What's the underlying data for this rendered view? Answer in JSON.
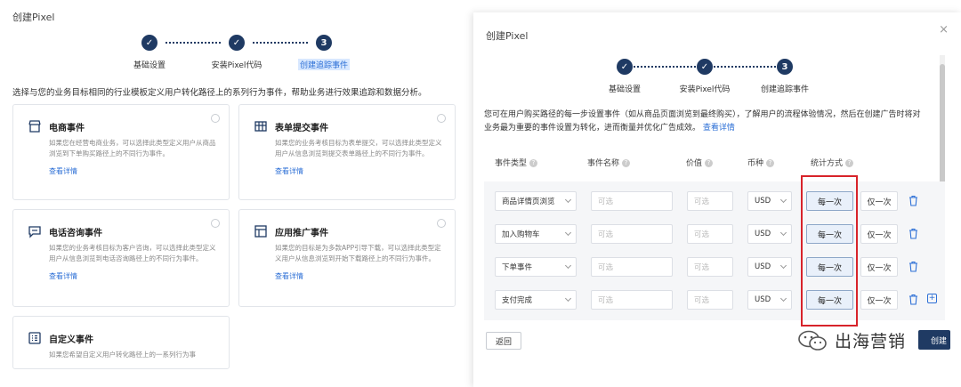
{
  "left": {
    "title": "创建Pixel",
    "steps": [
      {
        "label": "基础设置",
        "num": "✓"
      },
      {
        "label": "安装Pixel代码",
        "num": "✓"
      },
      {
        "label": "创建追踪事件",
        "num": "3"
      }
    ],
    "description": "选择与您的业务目标相同的行业模板定义用户转化路径上的系列行为事件，帮助业务进行效果追踪和数据分析。",
    "cards": [
      {
        "title": "电商事件",
        "desc": "如果您在经营电商业务，可以选择此类型定义用户从商品浏览到下单购买路径上的不同行为事件。",
        "link": "查看详情"
      },
      {
        "title": "表单提交事件",
        "desc": "如果您的业务考核目标为表单提交，可以选择此类型定义用户从信息浏览到提交表单路径上的不同行为事件。",
        "link": "查看详情"
      },
      {
        "title": "电话咨询事件",
        "desc": "如果您的业务考核目标为客户咨询，可以选择此类型定义用户从信息浏览到电话咨询路径上的不同行为事件。",
        "link": "查看详情"
      },
      {
        "title": "应用推广事件",
        "desc": "如果您的目标是为多款APP引导下载，可以选择此类型定义用户从信息浏览到开始下载路径上的不同行为事件。",
        "link": "查看详情"
      },
      {
        "title": "自定义事件",
        "desc": "如果您希望自定义用户转化路径上的一系列行为事",
        "link": ""
      }
    ]
  },
  "right": {
    "title": "创建Pixel",
    "close": "×",
    "steps": [
      {
        "label": "基础设置",
        "num": "✓"
      },
      {
        "label": "安装Pixel代码",
        "num": "✓"
      },
      {
        "label": "创建追踪事件",
        "num": "3"
      }
    ],
    "description": "您可在用户购买路径的每一步设置事件（如从商品页面浏览到最终购买），了解用户的流程体验情况，然后在创建广告时将对业务最为重要的事件设置为转化，进而衡量并优化广告成效。",
    "description_link": "查看详情",
    "headers": {
      "event_type": "事件类型",
      "event_name": "事件名称",
      "value": "价值",
      "currency": "币种",
      "count_method": "统计方式"
    },
    "rows": [
      {
        "type": "商品详情页浏览",
        "name_ph": "可选",
        "value_ph": "可选",
        "currency": "USD",
        "every": "每一次",
        "once": "仅一次"
      },
      {
        "type": "加入购物车",
        "name_ph": "可选",
        "value_ph": "可选",
        "currency": "USD",
        "every": "每一次",
        "once": "仅一次"
      },
      {
        "type": "下单事件",
        "name_ph": "可选",
        "value_ph": "可选",
        "currency": "USD",
        "every": "每一次",
        "once": "仅一次"
      },
      {
        "type": "支付完成",
        "name_ph": "可选",
        "value_ph": "可选",
        "currency": "USD",
        "every": "每一次",
        "once": "仅一次"
      }
    ],
    "back": "返回",
    "create": "创建"
  },
  "watermark": "出海营销"
}
